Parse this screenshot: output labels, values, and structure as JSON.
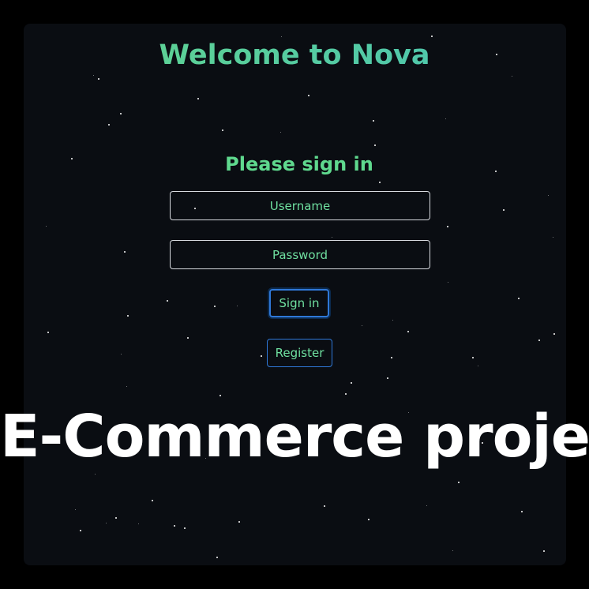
{
  "colors": {
    "background": "#0a0d12",
    "accent_green": "#5fd98e",
    "accent_teal": "#49c2b6",
    "button_border": "#2f78d8"
  },
  "header": {
    "title": "Welcome to Nova"
  },
  "login_form": {
    "heading": "Please sign in",
    "username": {
      "placeholder": "Username",
      "value": ""
    },
    "password": {
      "placeholder": "Password",
      "value": ""
    },
    "sign_in_label": "Sign in",
    "register_label": "Register"
  },
  "overlay": {
    "caption": "E-Commerce project"
  }
}
